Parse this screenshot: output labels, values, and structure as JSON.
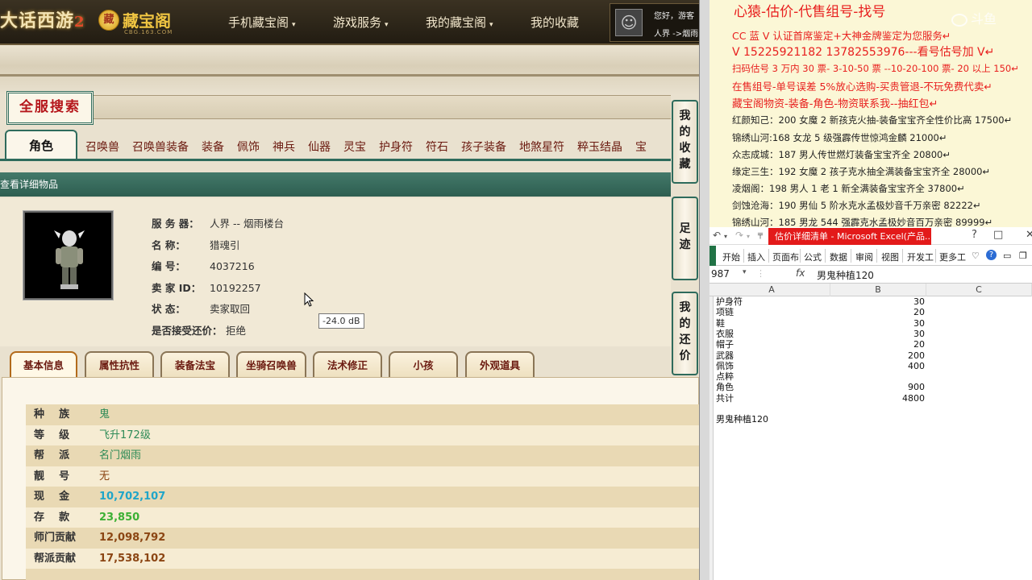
{
  "game": {
    "logo_text": "大话西游",
    "logo_num": "2",
    "cbg_logo": "藏宝阁",
    "cbg_domain": "CBG.163.COM",
    "nav": [
      {
        "label": "手机藏宝阁",
        "caret": "▾"
      },
      {
        "label": "游戏服务",
        "caret": "▾"
      },
      {
        "label": "我的藏宝阁",
        "caret": "▾"
      },
      {
        "label": "我的收藏",
        "caret": ""
      }
    ],
    "user_greeting": "您好，游客",
    "user_server": "人界 ->烟雨",
    "search_title": "全服搜索",
    "category_tabs": [
      "角色",
      "召唤兽",
      "召唤兽装备",
      "装备",
      "佩饰",
      "神兵",
      "仙器",
      "灵宝",
      "护身符",
      "符石",
      "孩子装备",
      "地煞星符",
      "粹玉结晶",
      "宝"
    ],
    "section_label": "查看详细物品",
    "info": [
      {
        "key": "服 务 器：",
        "value": "人界 -- 烟雨楼台"
      },
      {
        "key": "名        称：",
        "value": "猎魂引"
      },
      {
        "key": "编        号：",
        "value": "4037216"
      },
      {
        "key": "卖  家  ID：",
        "value": "10192257"
      },
      {
        "key": "状        态：",
        "value": "卖家取回"
      },
      {
        "key": "是否接受还价：",
        "value": "拒绝"
      }
    ],
    "tooltip": "-24.0 dB",
    "sub_tabs": [
      "基本信息",
      "属性抗性",
      "装备法宝",
      "坐骑召唤兽",
      "法术修正",
      "小孩",
      "外观道具"
    ],
    "details": [
      {
        "key": "种    族",
        "value": "鬼",
        "color": "#2e8b57"
      },
      {
        "key": "等    级",
        "value": "飞升172级",
        "color": "#2e8b57"
      },
      {
        "key": "帮    派",
        "value": "名门烟雨",
        "color": "#2e8b57"
      },
      {
        "key": "靓    号",
        "value": "无",
        "color": "#8b4513"
      },
      {
        "key": "现    金",
        "value": "10,702,107",
        "color": "#1fa5c9"
      },
      {
        "key": "存    款",
        "value": "23,850",
        "color": "#3cb034"
      },
      {
        "key": "师门贡献",
        "value": "12,098,792",
        "color": "#8b4513"
      },
      {
        "key": "帮派贡献",
        "value": "17,538,102",
        "color": "#8b4513"
      }
    ],
    "side_tabs": [
      [
        "我",
        "的",
        "收",
        "藏"
      ],
      [
        "足",
        "迹"
      ],
      [
        "我",
        "的",
        "还",
        "价"
      ]
    ]
  },
  "notice": {
    "title": "心猿-估价-代售组号-找号",
    "lines": [
      {
        "text": "CC 蓝 V 认证首席鉴定+大神金牌鉴定为您服务↵",
        "red": true
      },
      {
        "text": "V 15225921182      13782553976---看号估号加 V↵",
        "red": true
      },
      {
        "text": "扫码估号 3 万内 30 票- 3-10-50 票  --10-20-100 票- 20 以上 150↵",
        "red": true
      },
      {
        "text": "在售组号-单号误差 5%放心选购-买贵管退-不玩免费代卖↵",
        "red": true
      },
      {
        "text": "藏宝阁物资-装备-角色-物资联系我--抽红包↵",
        "red": true
      },
      {
        "text": "红颜知己：200 女魔 2 新孩克火抽-装备宝宝齐全性价比高 17500↵",
        "red": false
      },
      {
        "text": "锦绣山河:168 女龙 5 级强霹传世惊鸿金麟 21000↵",
        "red": false
      },
      {
        "text": "众志成城：187 男人传世燃灯装备宝宝齐全 20800↵",
        "red": false
      },
      {
        "text": "缘定三生：192 女魔 2 孩子克水抽全满装备宝宝齐全 28000↵",
        "red": false
      },
      {
        "text": "凌烟阁：198 男人 1 老 1 新全满装备宝宝齐全 37800↵",
        "red": false
      },
      {
        "text": "剑蚀沧海：190 男仙 5 阶水克水孟极妙音千万亲密 82222↵",
        "red": false
      },
      {
        "text": "锦绣山河：185 男龙 544 强霹克水孟极妙音百万亲密 89999↵",
        "red": false
      }
    ],
    "watermark": "斗鱼"
  },
  "excel": {
    "title": "估价详细清单 - Microsoft Excel(产品...",
    "ribbon_tabs": [
      "开始",
      "插入",
      "页面布",
      "公式",
      "数据",
      "审阅",
      "视图",
      "开发工",
      "更多工"
    ],
    "name_box": "987",
    "fx": "fx",
    "formula": "男鬼种植120",
    "columns": [
      "A",
      "B",
      "C"
    ],
    "rows": [
      {
        "a": "护身符",
        "b": "30"
      },
      {
        "a": "项链",
        "b": "20"
      },
      {
        "a": "鞋",
        "b": "30"
      },
      {
        "a": "衣服",
        "b": "30"
      },
      {
        "a": "帽子",
        "b": "20"
      },
      {
        "a": "武器",
        "b": "200"
      },
      {
        "a": "佩饰",
        "b": "400"
      },
      {
        "a": "点粹",
        "b": ""
      },
      {
        "a": "角色",
        "b": "900"
      },
      {
        "a": "共计",
        "b": "4800"
      },
      {
        "a": "",
        "b": ""
      },
      {
        "a": "男鬼种植120",
        "b": ""
      }
    ]
  }
}
